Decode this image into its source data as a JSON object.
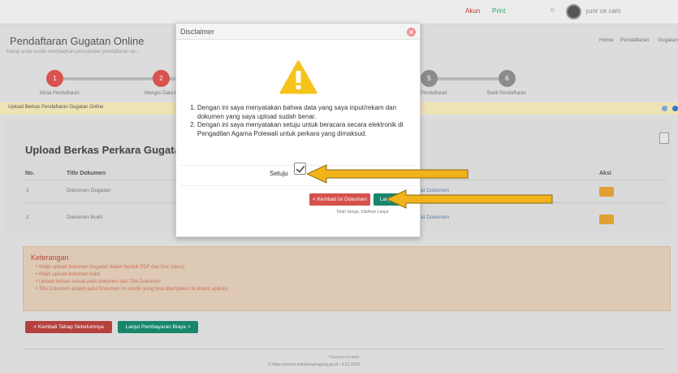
{
  "topbar": {
    "help_label": "Akun",
    "print_label": "Print",
    "user_name": "yunr ce cam"
  },
  "page": {
    "title": "Pendaftaran Gugatan Online",
    "subtitle": "Harap anda sudah menyiapkan persyaratan pendaftaran se...",
    "breadcrumb": [
      "Home",
      "Pendaftaran",
      "Gugatan"
    ]
  },
  "steps": [
    {
      "num": "1",
      "label": "Mulai Pendaftaran",
      "color": "#d9534f"
    },
    {
      "num": "2",
      "label": "Mengisi Data Pih...",
      "color": "#d9534f"
    },
    {
      "num": "5",
      "label": "Pendaftaran",
      "color": "#8c8c8c"
    },
    {
      "num": "6",
      "label": "Bukti Pendaftaran",
      "color": "#8c8c8c"
    }
  ],
  "notice": {
    "text": "Upload Berkas Pendaftaran Gugatan Online"
  },
  "card": {
    "title": "Upload Berkas Perkara Gugatan"
  },
  "table": {
    "headers": {
      "no": "No.",
      "title": "Title Dokumen",
      "aksi": "Aksi"
    },
    "rows": [
      {
        "no": "1",
        "title": "Dokumen Gugatan",
        "status": "at Dokumen"
      },
      {
        "no": "2",
        "title": "Dokumen Bukti",
        "status": "at Dokumen"
      }
    ]
  },
  "keterangan": {
    "title": "Keterangan",
    "items": [
      "Wajib upload dokumen Gugatan dalam bentuk PDF dan Doc (docx)",
      "Wajib upload dokumen bukti",
      "Upload berkas sesuai jenis dokumen dan Title Dokumen",
      "Title Dokumen adalah judul Dokumen ini sendiri yang bisa ditampilkan di sistem aplikasi"
    ]
  },
  "buttons": {
    "back": "< Kembali Tahap Sebelumnya",
    "next": "Lanjut Pembayaran Biaya >"
  },
  "footer": {
    "line1": "Halaman terakhir",
    "line2": "© https://ecourt.mahkamahagung.go.id  • 0.01 2020"
  },
  "modal": {
    "title": "Disclaimer",
    "terms": [
      "Dengan ini saya menyatakan bahwa data yang saya input/rekam dan dokumen yang saya upload sudah benar.",
      "Dengan ini saya menyatakan setuju untuk beracara secara elektronik di Pengadilan Agama Polewali untuk perkara yang dimaksud."
    ],
    "agree_label": "Setuju",
    "back_button": "< Kembali Isi Dokumen",
    "next_button": "Lanjut >",
    "hint": "Telah Setuju, Silahkan Lanjut",
    "accent": "#18866b"
  },
  "annotations": {
    "arrow_color": "#f0b31a"
  }
}
